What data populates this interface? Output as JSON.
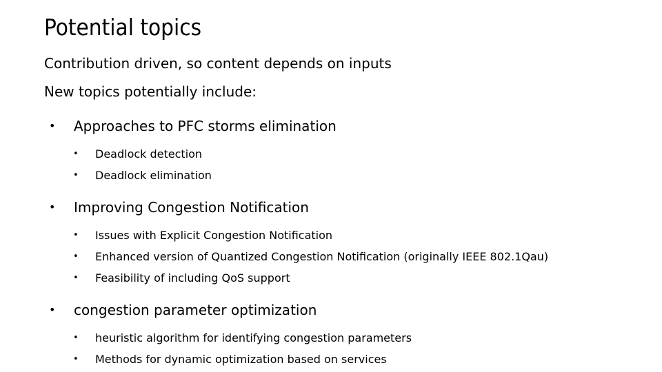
{
  "slide": {
    "title": "Potential topics",
    "intro_lines": [
      "Contribution driven, so content depends on inputs",
      "New topics potentially include:"
    ],
    "bullet_char": "•",
    "sections": [
      {
        "heading": "Approaches to PFC storms elimination",
        "items": [
          "Deadlock detection",
          "Deadlock elimination"
        ]
      },
      {
        "heading": "Improving Congestion Notification",
        "items": [
          "Issues with Explicit Congestion Notification",
          "Enhanced version of Quantized Congestion Notification (originally IEEE 802.1Qau)",
          "Feasibility of including QoS support"
        ]
      },
      {
        "heading": "congestion parameter optimization",
        "items": [
          "heuristic algorithm for identifying congestion parameters",
          "Methods for dynamic optimization based on services"
        ]
      }
    ]
  }
}
